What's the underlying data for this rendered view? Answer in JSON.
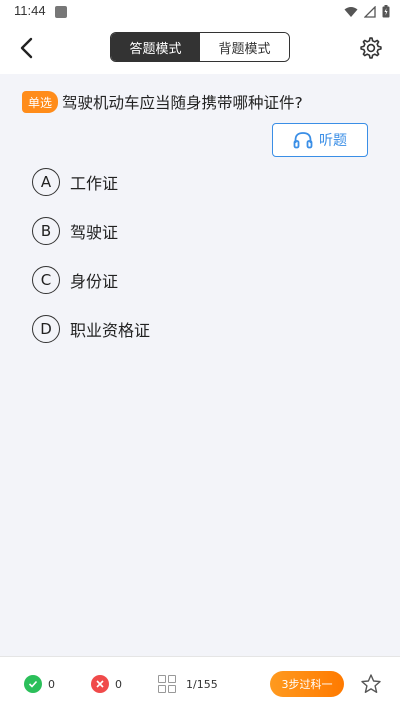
{
  "status": {
    "time": "11:44"
  },
  "header": {
    "modes": [
      {
        "label": "答题模式",
        "active": true
      },
      {
        "label": "背题模式",
        "active": false
      }
    ]
  },
  "question": {
    "type_badge": "单选",
    "text": "驾驶机动车应当随身携带哪种证件?"
  },
  "listen_button": {
    "label": "听题"
  },
  "options": [
    {
      "letter": "A",
      "text": "工作证"
    },
    {
      "letter": "B",
      "text": "驾驶证"
    },
    {
      "letter": "C",
      "text": "身份证"
    },
    {
      "letter": "D",
      "text": "职业资格证"
    }
  ],
  "bottom": {
    "correct_count": "0",
    "wrong_count": "0",
    "progress": "1/155",
    "pass_button": "3步过科一"
  },
  "colors": {
    "accent_orange": "#ff8c1a",
    "accent_blue": "#3a8ee6",
    "correct_green": "#2bbf5a",
    "wrong_red": "#f04a4a"
  },
  "icons": [
    "back-arrow-icon",
    "settings-gear-icon",
    "headphones-icon",
    "check-icon",
    "cross-icon",
    "grid-icon",
    "star-icon",
    "wifi-icon",
    "signal-icon",
    "battery-icon"
  ]
}
